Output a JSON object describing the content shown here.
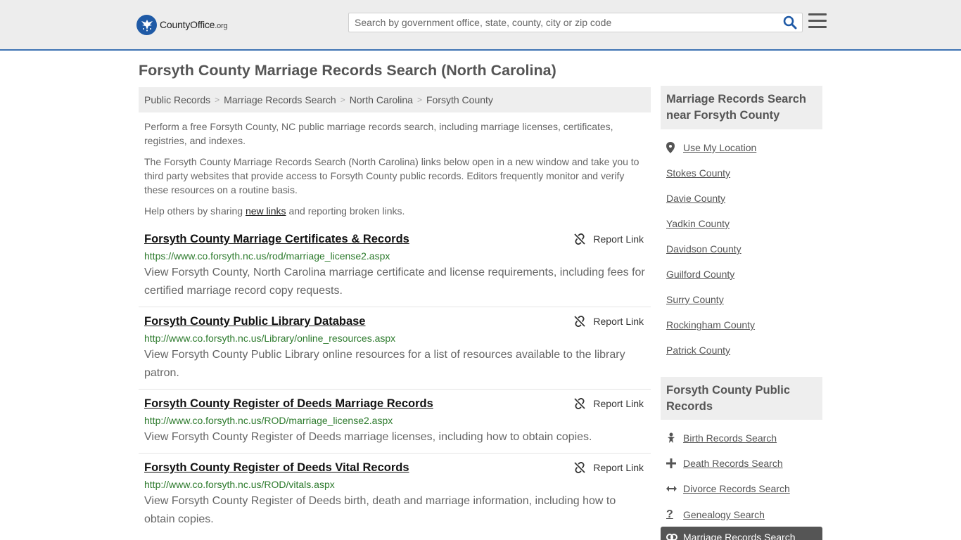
{
  "header": {
    "logo_main": "CountyOffice",
    "logo_suffix": ".org",
    "search_placeholder": "Search by government office, state, county, city or zip code"
  },
  "page_title": "Forsyth County Marriage Records Search (North Carolina)",
  "breadcrumb": [
    "Public Records",
    "Marriage Records Search",
    "North Carolina",
    "Forsyth County"
  ],
  "intro": {
    "p1": "Perform a free Forsyth County, NC public marriage records search, including marriage licenses, certificates, registries, and indexes.",
    "p2": "The Forsyth County Marriage Records Search (North Carolina) links below open in a new window and take you to third party websites that provide access to Forsyth County public records. Editors frequently monitor and verify these resources on a routine basis.",
    "p3_before": "Help others by sharing ",
    "p3_link": "new links",
    "p3_after": " and reporting broken links."
  },
  "report_label": "Report Link",
  "results": [
    {
      "title": "Forsyth County Marriage Certificates & Records",
      "url": "https://www.co.forsyth.nc.us/rod/marriage_license2.aspx",
      "desc": "View Forsyth County, North Carolina marriage certificate and license requirements, including fees for certified marriage record copy requests."
    },
    {
      "title": "Forsyth County Public Library Database",
      "url": "http://www.co.forsyth.nc.us/Library/online_resources.aspx",
      "desc": "View Forsyth County Public Library online resources for a list of resources available to the library patron."
    },
    {
      "title": "Forsyth County Register of Deeds Marriage Records",
      "url": "http://www.co.forsyth.nc.us/ROD/marriage_license2.aspx",
      "desc": "View Forsyth County Register of Deeds marriage licenses, including how to obtain copies."
    },
    {
      "title": "Forsyth County Register of Deeds Vital Records",
      "url": "http://www.co.forsyth.nc.us/ROD/vitals.aspx",
      "desc": "View Forsyth County Register of Deeds birth, death and marriage information, including how to obtain copies."
    }
  ],
  "sidebar": {
    "nearby_title": "Marriage Records Search near Forsyth County",
    "use_location": "Use My Location",
    "nearby": [
      "Stokes County",
      "Davie County",
      "Yadkin County",
      "Davidson County",
      "Guilford County",
      "Surry County",
      "Rockingham County",
      "Patrick County"
    ],
    "records_title": "Forsyth County Public Records",
    "records": [
      {
        "label": "Birth Records Search",
        "icon": "baby-icon"
      },
      {
        "label": "Death Records Search",
        "icon": "cross-icon"
      },
      {
        "label": "Divorce Records Search",
        "icon": "arrows-horizontal-icon"
      },
      {
        "label": "Genealogy Search",
        "icon": "question-icon"
      }
    ],
    "active_record": {
      "label": "Marriage Records Search",
      "icon": "rings-icon"
    }
  },
  "colors": {
    "brand_blue": "#1f5aa6",
    "header_border": "#3d73b3",
    "url_green": "#2c7a2c"
  }
}
